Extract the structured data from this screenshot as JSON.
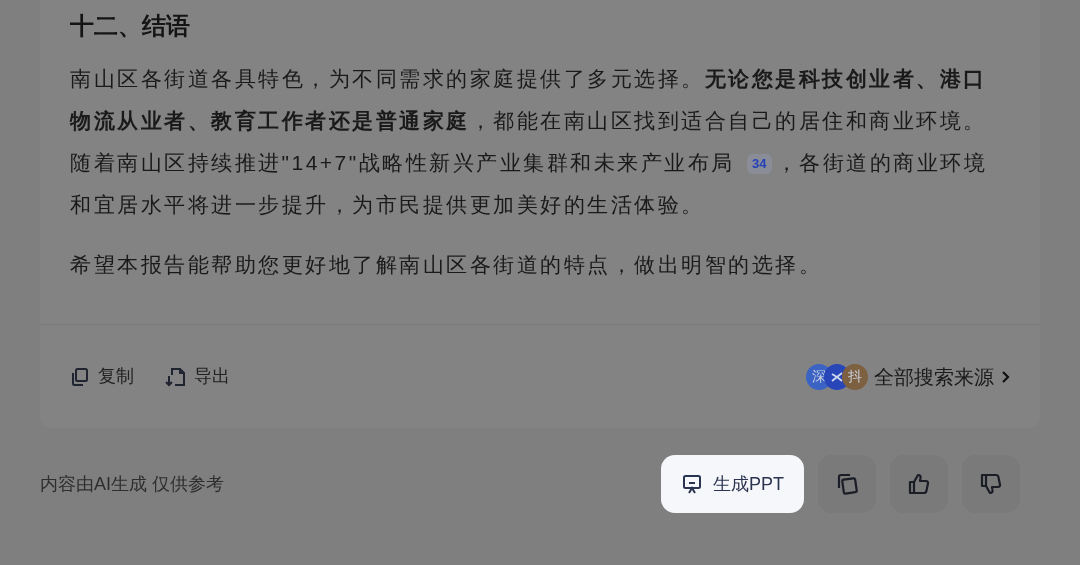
{
  "section": {
    "heading": "十二、结语",
    "paragraph_1": {
      "text_before": "南山区各街道各具特色，为不同需求的家庭提供了多元选择。**无论您是科技创业者、港口物流从业者、教育工作者还是普通家庭**，都能在南山区找到适合自己的居住和商业环境。随着南山区持续推进\"14+7\"战略性新兴产业集群和未来产业布局",
      "citation": "34",
      "text_after": "，各街道的商业环境和宜居水平将进一步提升，为市民提供更加美好的生活体验。"
    },
    "paragraph_2": "希望本报告能帮助您更好地了解南山区各街道的特点，做出明智的选择。"
  },
  "actions": [
    {
      "kind": "copy",
      "label": "复制"
    },
    {
      "kind": "export",
      "label": "导出"
    }
  ],
  "sources": {
    "avatars": [
      {
        "text": "深",
        "color": "#3b63c4"
      },
      {
        "color": "#2946b8"
      },
      {
        "text": "抖",
        "color": "#7d6040"
      }
    ],
    "label": "全部搜索来源"
  },
  "disclaimer": "内容由AI生成 仅供参考",
  "toolbar": [
    {
      "kind": "ppt",
      "label": "生成PPT",
      "highlighted": true
    },
    {
      "kind": "copy",
      "highlighted": false
    },
    {
      "kind": "like",
      "highlighted": false
    },
    {
      "kind": "dislike",
      "highlighted": false
    }
  ]
}
